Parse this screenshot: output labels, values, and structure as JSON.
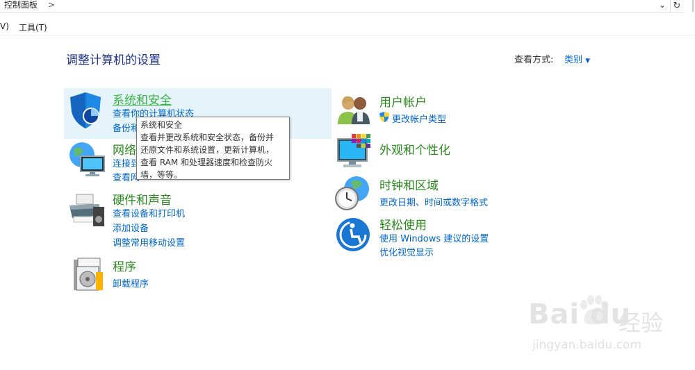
{
  "address_bar": {
    "crumb": "控制面板",
    "separator": ">",
    "dropdown": "⌄",
    "refresh": "↻"
  },
  "menu": {
    "view": "V)",
    "tools": "工具(T)"
  },
  "page_title": "调整计算机的设置",
  "view_by": {
    "label": "查看方式:",
    "value": "类别"
  },
  "categories": [
    {
      "title": "系统和安全",
      "links": [
        "查看你的计算机状态",
        "备份和"
      ]
    },
    {
      "title": "网络",
      "links": [
        "连接到",
        "查看网"
      ]
    },
    {
      "title": "硬件和声音",
      "links": [
        "查看设备和打印机",
        "添加设备",
        "调整常用移动设置"
      ]
    },
    {
      "title": "程序",
      "links": [
        "卸载程序"
      ]
    },
    {
      "title": "用户帐户",
      "links": [
        "更改帐户类型"
      ]
    },
    {
      "title": "外观和个性化",
      "links": []
    },
    {
      "title": "时钟和区域",
      "links": [
        "更改日期、时间或数字格式"
      ]
    },
    {
      "title": "轻松使用",
      "links": [
        "使用 Windows 建议的设置",
        "优化视觉显示"
      ]
    }
  ],
  "tooltip": {
    "title": "系统和安全",
    "line1": "查看并更改系统和安全状态，备份并",
    "line2": "还原文件和系统设置，更新计算机，",
    "line3": "查看 RAM 和处理器速度和检查防火",
    "line4": "墙，等等。"
  },
  "watermark": {
    "brand": "Bai  du",
    "cn": "经验",
    "url": "jingyan.baidu.com"
  },
  "colors": {
    "category_title": "#2b8a1e",
    "link": "#0066cc",
    "page_title": "#1e3287",
    "highlight": "#e5f3fb"
  }
}
